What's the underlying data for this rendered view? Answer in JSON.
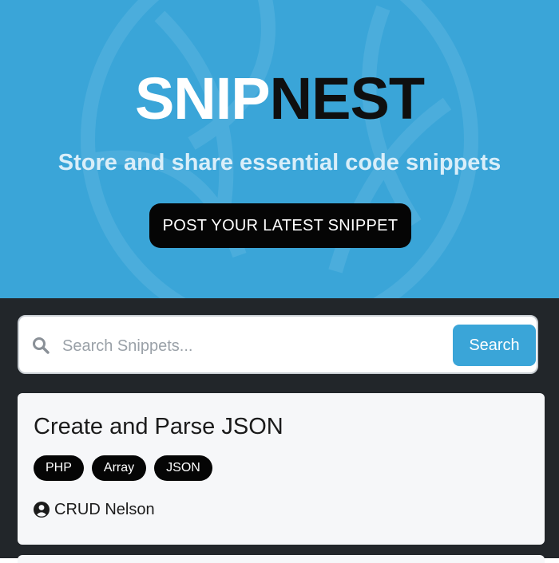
{
  "hero": {
    "brand_snip": "SNIP",
    "brand_nest": "NEST",
    "tagline": "Store and share essential code snippets",
    "post_button_label": "POST YOUR LATEST SNIPPET"
  },
  "search": {
    "placeholder": "Search Snippets...",
    "value": "",
    "button_label": "Search",
    "icon": "search-icon"
  },
  "snippets": [
    {
      "title": "Create and Parse JSON",
      "tags": [
        "PHP",
        "Array",
        "JSON"
      ],
      "author": "CRUD Nelson",
      "author_icon": "user-circle-icon"
    }
  ],
  "colors": {
    "accent": "#3aa5d8",
    "dark": "#22262a",
    "button_dark": "#050505",
    "card_bg": "#f6f7f9"
  }
}
